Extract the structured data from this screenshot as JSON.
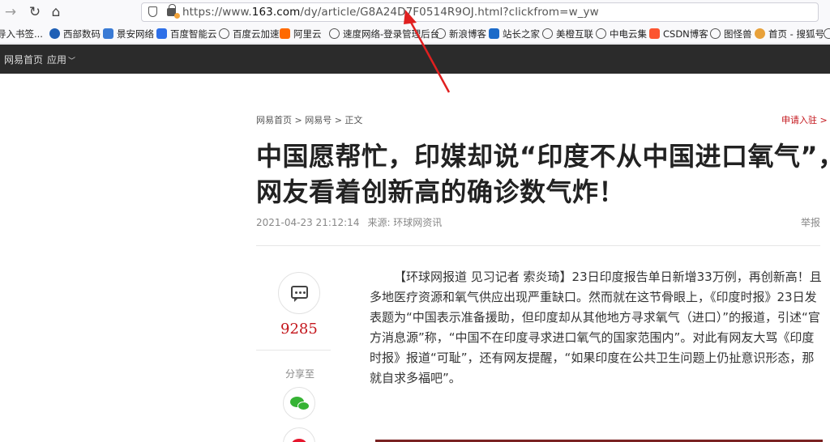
{
  "browser": {
    "url_prefix": "https://www.",
    "url_host": "163.com",
    "url_path": "/dy/article/G8A24D7F0514R9OJ.html?clickfrom=w_yw",
    "bookmarks": [
      {
        "label": "导入书签...",
        "icon": "folder-icon",
        "color": "#f0b429"
      },
      {
        "label": "西部数码",
        "icon": "west-icon",
        "color": "#1f5fb5"
      },
      {
        "label": "景安网络",
        "icon": "jingan-icon",
        "color": "#3a7bd5"
      },
      {
        "label": "百度智能云",
        "icon": "baidu-cloud-icon",
        "color": "#2e6fe8"
      },
      {
        "label": "百度云加速",
        "icon": "globe-icon",
        "color": "#555555"
      },
      {
        "label": "阿里云",
        "icon": "aliyun-icon",
        "color": "#ff6a00"
      },
      {
        "label": "速度网络-登录管理后台",
        "icon": "globe-icon",
        "color": "#555555"
      },
      {
        "label": "新浪博客",
        "icon": "globe-icon",
        "color": "#555555"
      },
      {
        "label": "站长之家",
        "icon": "chinaz-icon",
        "color": "#1b6ac9"
      },
      {
        "label": "美橙互联",
        "icon": "globe-icon",
        "color": "#555555"
      },
      {
        "label": "中电云集",
        "icon": "globe-icon",
        "color": "#555555"
      },
      {
        "label": "CSDN博客",
        "icon": "csdn-icon",
        "color": "#fc5531"
      },
      {
        "label": "图怪兽",
        "icon": "globe-icon",
        "color": "#555555"
      },
      {
        "label": "首页 - 搜狐号",
        "icon": "sohu-icon",
        "color": "#e8a13a"
      }
    ]
  },
  "sitenav": {
    "home": "网易首页",
    "apps": "应用"
  },
  "article": {
    "breadcrumb": "网易首页 > 网易号 > 正文",
    "apply": "申请入驻 >",
    "title_line1": "中国愿帮忙，印媒却说“印度不从中国进口氧气”，",
    "title_line2": "网友看着创新高的确诊数气炸！",
    "date": "2021-04-23 21:12:14",
    "source": "来源: 环球网资讯",
    "report": "举报",
    "comment_count": "9285",
    "share_label": "分享至",
    "body": "【环球网报道 见习记者 索炎琦】23日印度报告单日新增33万例，再创新高！且多地医疗资源和氧气供应出现严重缺口。然而就在这节骨眼上，《印度时报》23日发表题为“中国表示准备援助，但印度却从其他地方寻求氧气（进口）”的报道，引述“官方消息源”称，“中国不在印度寻求进口氧气的国家范围内”。对此有网友大骂《印度时报》报道“可耻”，还有网友提醒，“如果印度在公共卫生问题上仍扯意识形态，那就自求多福吧”。"
  },
  "colors": {
    "accent_red": "#c4161c",
    "nav_dark": "#2b2b2b",
    "arrow_red": "#e02020"
  }
}
